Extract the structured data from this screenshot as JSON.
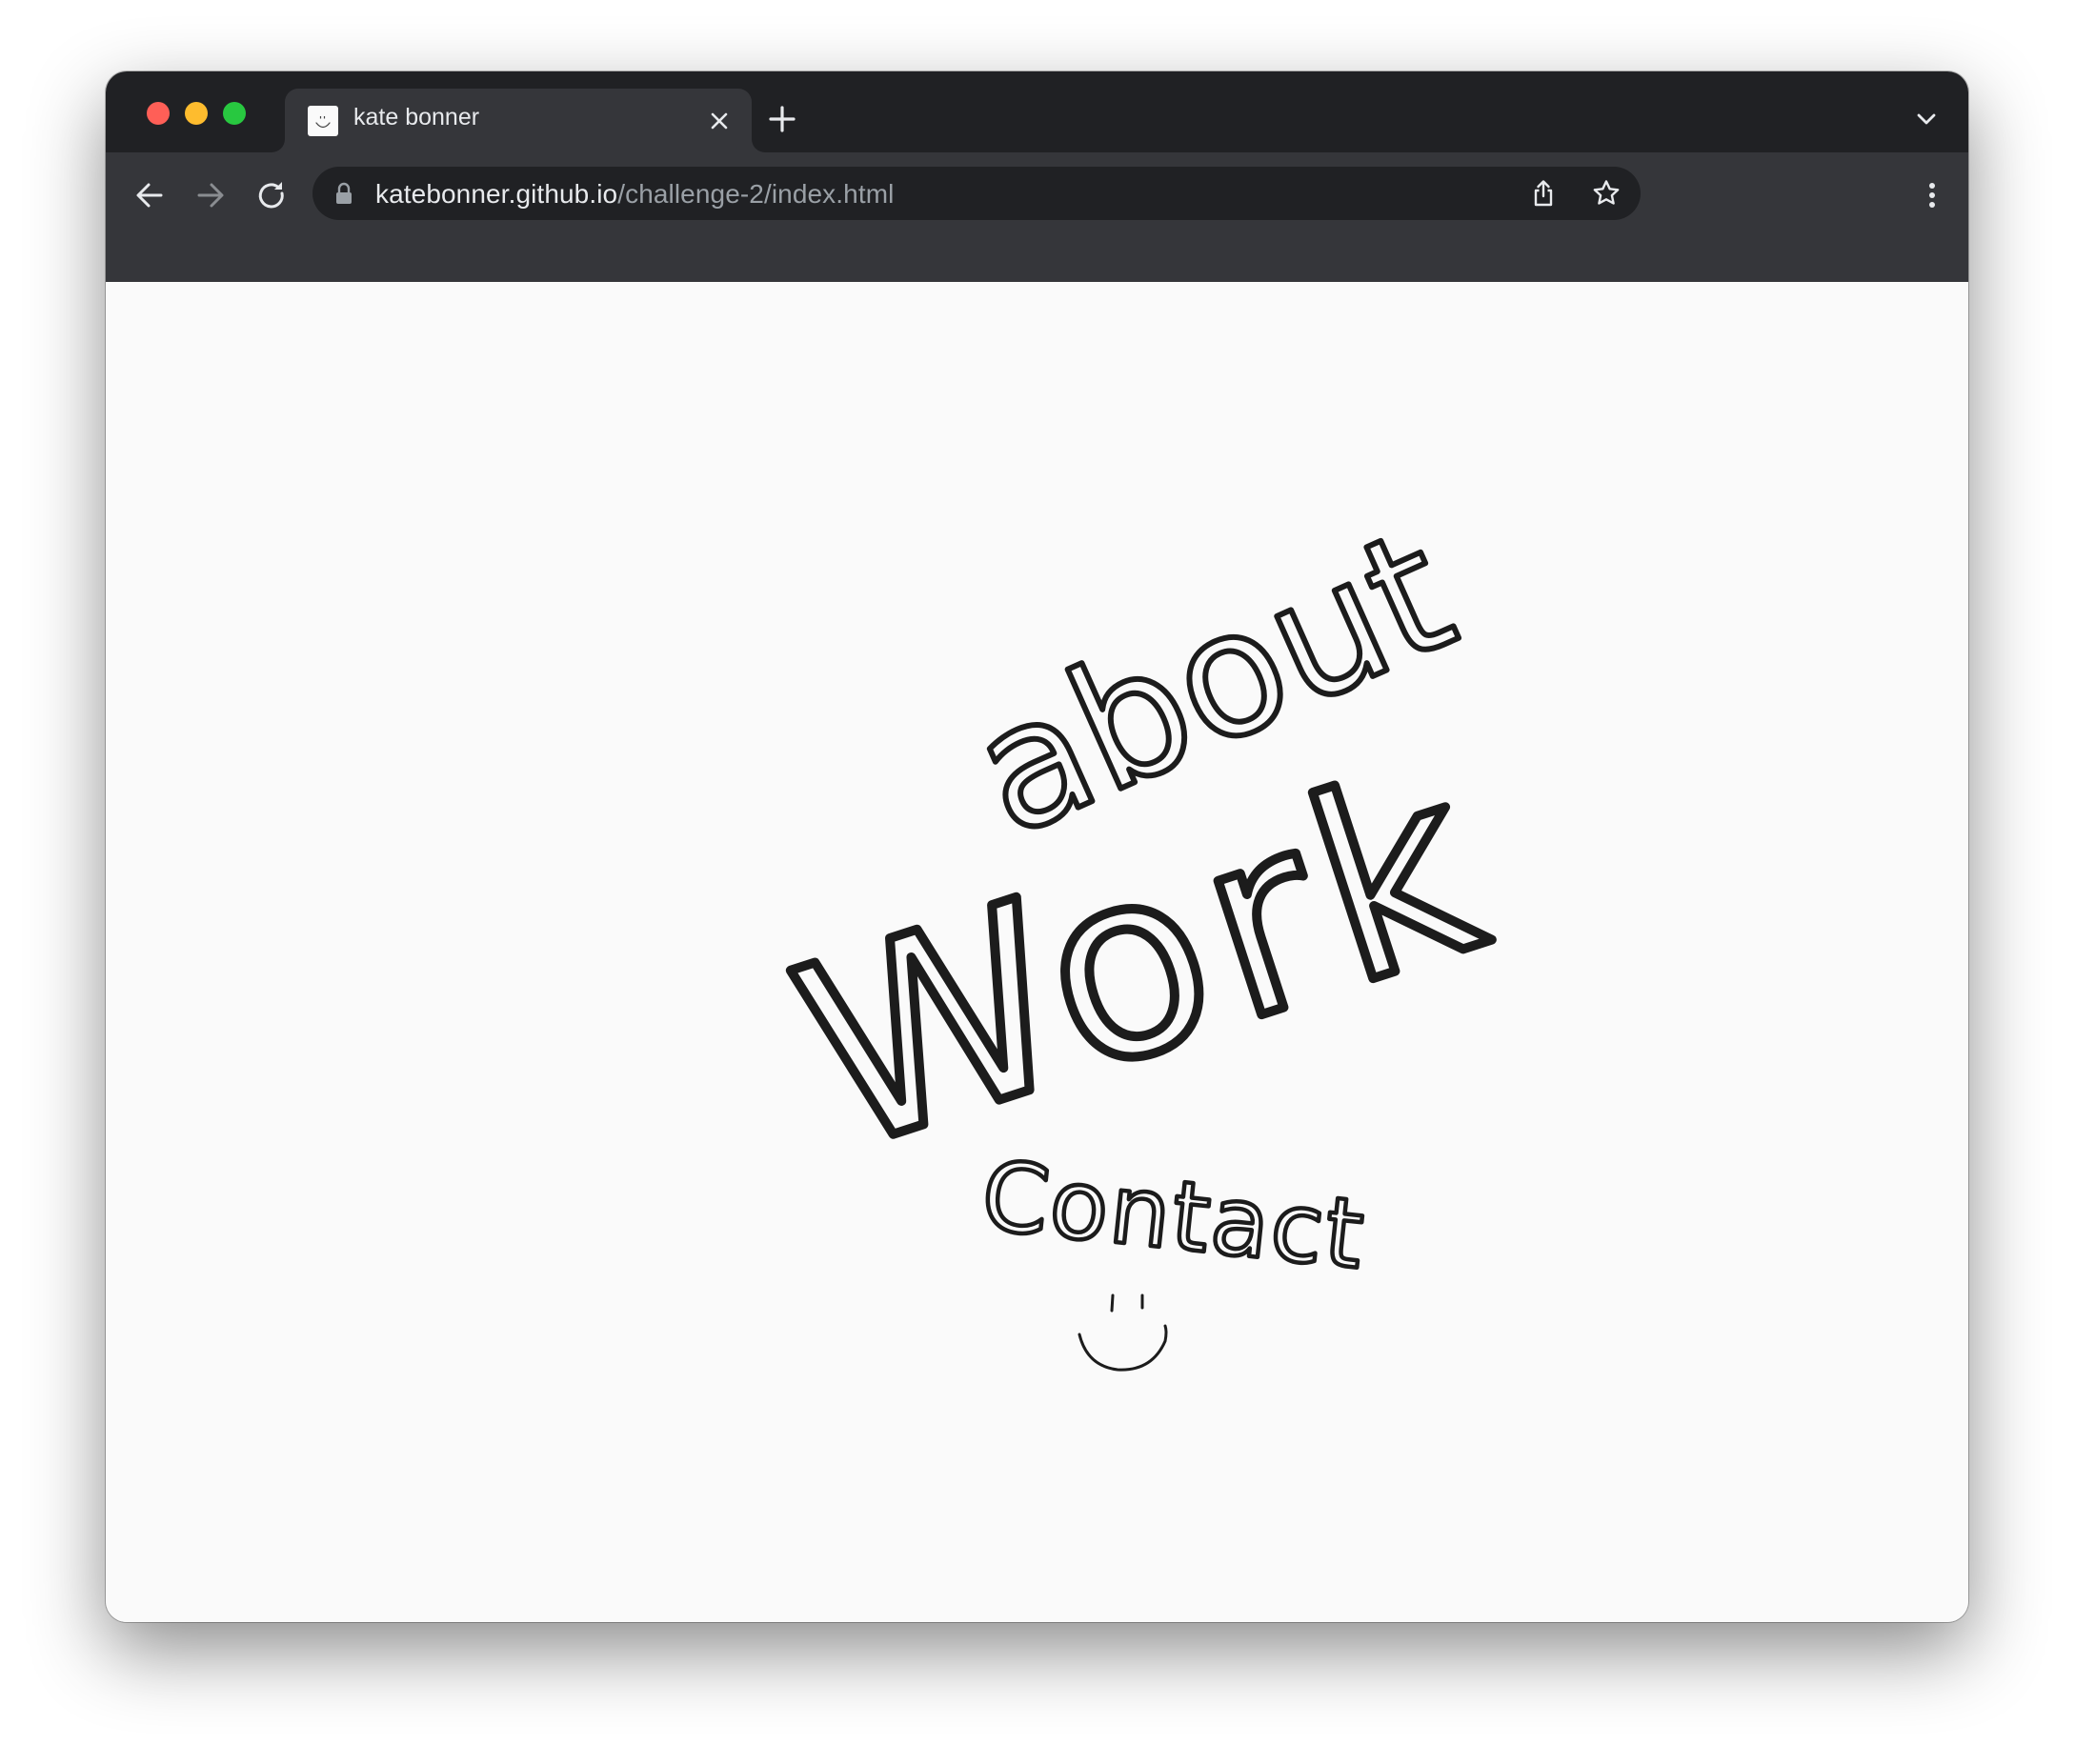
{
  "browser": {
    "tab_title": "kate bonner",
    "url_host": "katebonner.github.io",
    "url_path": "/challenge-2/index.html"
  },
  "page": {
    "nav": {
      "about": "about",
      "work": "Work",
      "contact": "Contact"
    },
    "smiley_icon": "smiley-face-icon"
  },
  "colors": {
    "tabstrip": "#202124",
    "toolbar": "#35363a",
    "omnibox": "#202124",
    "page_background": "#fafafa",
    "ink": "#1c1c1c"
  }
}
